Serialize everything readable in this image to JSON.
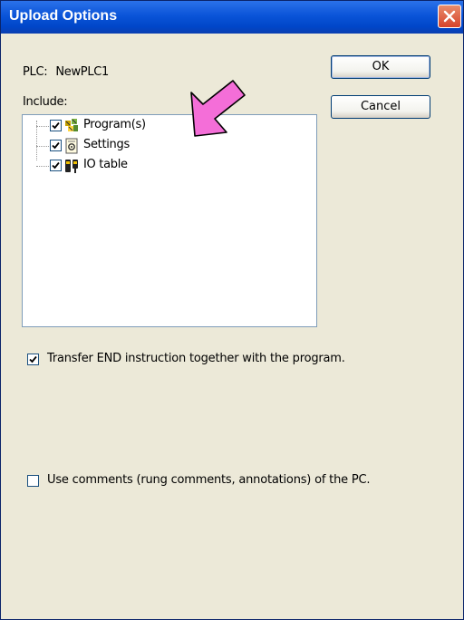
{
  "window": {
    "title": "Upload Options"
  },
  "plc": {
    "label": "PLC:",
    "name": "NewPLC1"
  },
  "include": {
    "label": "Include:",
    "items": [
      {
        "label": "Program(s)",
        "checked": true,
        "icon": "programs-icon"
      },
      {
        "label": "Settings",
        "checked": true,
        "icon": "settings-icon"
      },
      {
        "label": "IO table",
        "checked": true,
        "icon": "io-table-icon"
      }
    ]
  },
  "buttons": {
    "ok": "OK",
    "cancel": "Cancel"
  },
  "options": {
    "transfer_end": {
      "label": "Transfer END instruction together with the program.",
      "checked": true
    },
    "use_comments": {
      "label": "Use comments (rung comments, annotations) of the PC.",
      "checked": false
    }
  },
  "colors": {
    "titlebar": "#0a54d8",
    "dialog_bg": "#ece9d8",
    "arrow": "#f46ed8",
    "close_button": "#d7432b"
  }
}
